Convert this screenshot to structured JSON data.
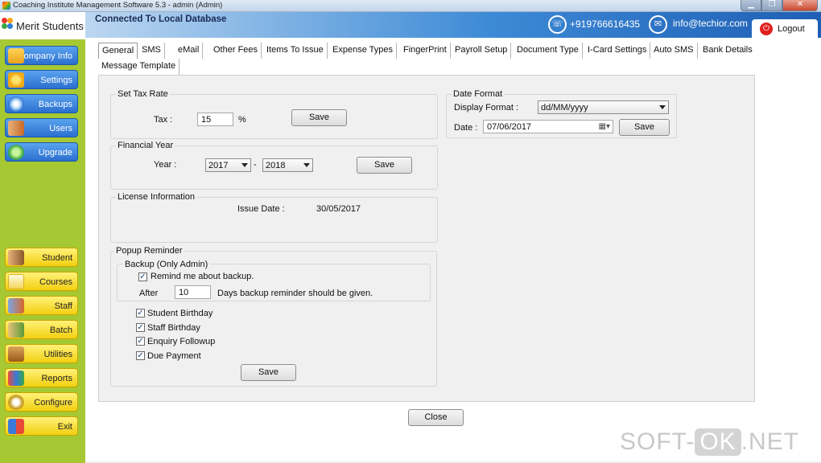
{
  "window": {
    "title": "Coaching Institute Management Software 5.3  -  admin (Admin)",
    "minimize": "▁",
    "restore": "❐",
    "close": "✕"
  },
  "brand": {
    "name": "Merit Students"
  },
  "header": {
    "connection": "Connected To  Local Database",
    "phone": "+919766616435",
    "email": "info@techior.com",
    "logout": "Logout"
  },
  "sidebar": {
    "top_items": [
      {
        "label": "Company Info",
        "icon": "folder-icon"
      },
      {
        "label": "Settings",
        "icon": "gears-icon"
      },
      {
        "label": "Backups",
        "icon": "disc-icon"
      },
      {
        "label": "Users",
        "icon": "users-icon"
      },
      {
        "label": "Upgrade",
        "icon": "refresh-icon"
      }
    ],
    "bottom_items": [
      {
        "label": "Student",
        "icon": "students-icon"
      },
      {
        "label": "Courses",
        "icon": "document-icon"
      },
      {
        "label": "Staff",
        "icon": "staff-icon"
      },
      {
        "label": "Batch",
        "icon": "batch-icon"
      },
      {
        "label": "Utilities",
        "icon": "toolbox-icon"
      },
      {
        "label": "Reports",
        "icon": "reports-icon"
      },
      {
        "label": "Configure",
        "icon": "gear-icon"
      },
      {
        "label": "Exit",
        "icon": "exit-icon"
      }
    ]
  },
  "tabs": [
    "General",
    "SMS",
    "eMail",
    "Other Fees",
    "Items To Issue",
    "Expense Types",
    "FingerPrint",
    "Payroll Setup",
    "Document Type",
    "I-Card Settings",
    "Auto SMS",
    "Bank Details",
    "Message Template"
  ],
  "active_tab": "General",
  "tax": {
    "legend": "Set Tax Rate",
    "label": "Tax :",
    "value": "15",
    "unit": "%",
    "save": "Save"
  },
  "financial_year": {
    "legend": "Financial Year",
    "label": "Year :",
    "from": "2017",
    "sep": "-",
    "to": "2018",
    "save": "Save"
  },
  "license": {
    "legend": "License Information",
    "issue_label": "Issue Date :",
    "issue_date": "30/05/2017"
  },
  "popup": {
    "legend": "Popup Reminder",
    "backup_legend": "Backup (Only Admin)",
    "remind_label": "Remind me about backup.",
    "after_label": "After",
    "days_value": "10",
    "days_text": "Days backup  reminder should be given.",
    "checks": [
      "Student Birthday",
      "Staff Birthday",
      "Enquiry Followup",
      "Due Payment"
    ],
    "save": "Save"
  },
  "date_format": {
    "legend": "Date Format",
    "display_label": "Display Format :",
    "display_value": "dd/MM/yyyy",
    "date_label": "Date :",
    "date_value": "07/06/2017",
    "save": "Save"
  },
  "close_button": "Close",
  "watermark": {
    "left": "SOFT-",
    "ok": "OK",
    "right": ".NET"
  }
}
